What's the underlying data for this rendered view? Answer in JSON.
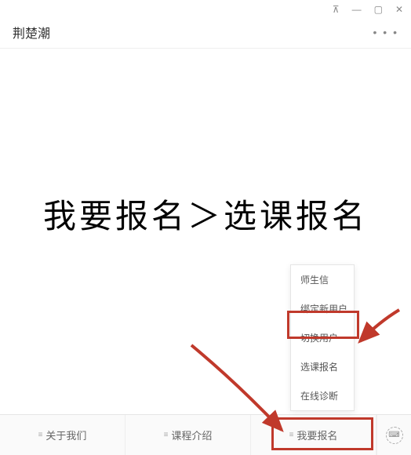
{
  "window": {
    "title": "荆楚潮"
  },
  "titlebar": {
    "pin": "⊼",
    "min": "—",
    "max": "▢",
    "close": "✕"
  },
  "header": {
    "more": "• • •"
  },
  "content": {
    "handwriting": "我要报名＞选课报名"
  },
  "popup": {
    "items": [
      "师生信",
      "绑定新用户",
      "切换用户",
      "选课报名",
      "在线诊断"
    ]
  },
  "nav": {
    "items": [
      "关于我们",
      "课程介绍",
      "我要报名"
    ]
  },
  "keyboard": {
    "glyph": "⌨"
  }
}
